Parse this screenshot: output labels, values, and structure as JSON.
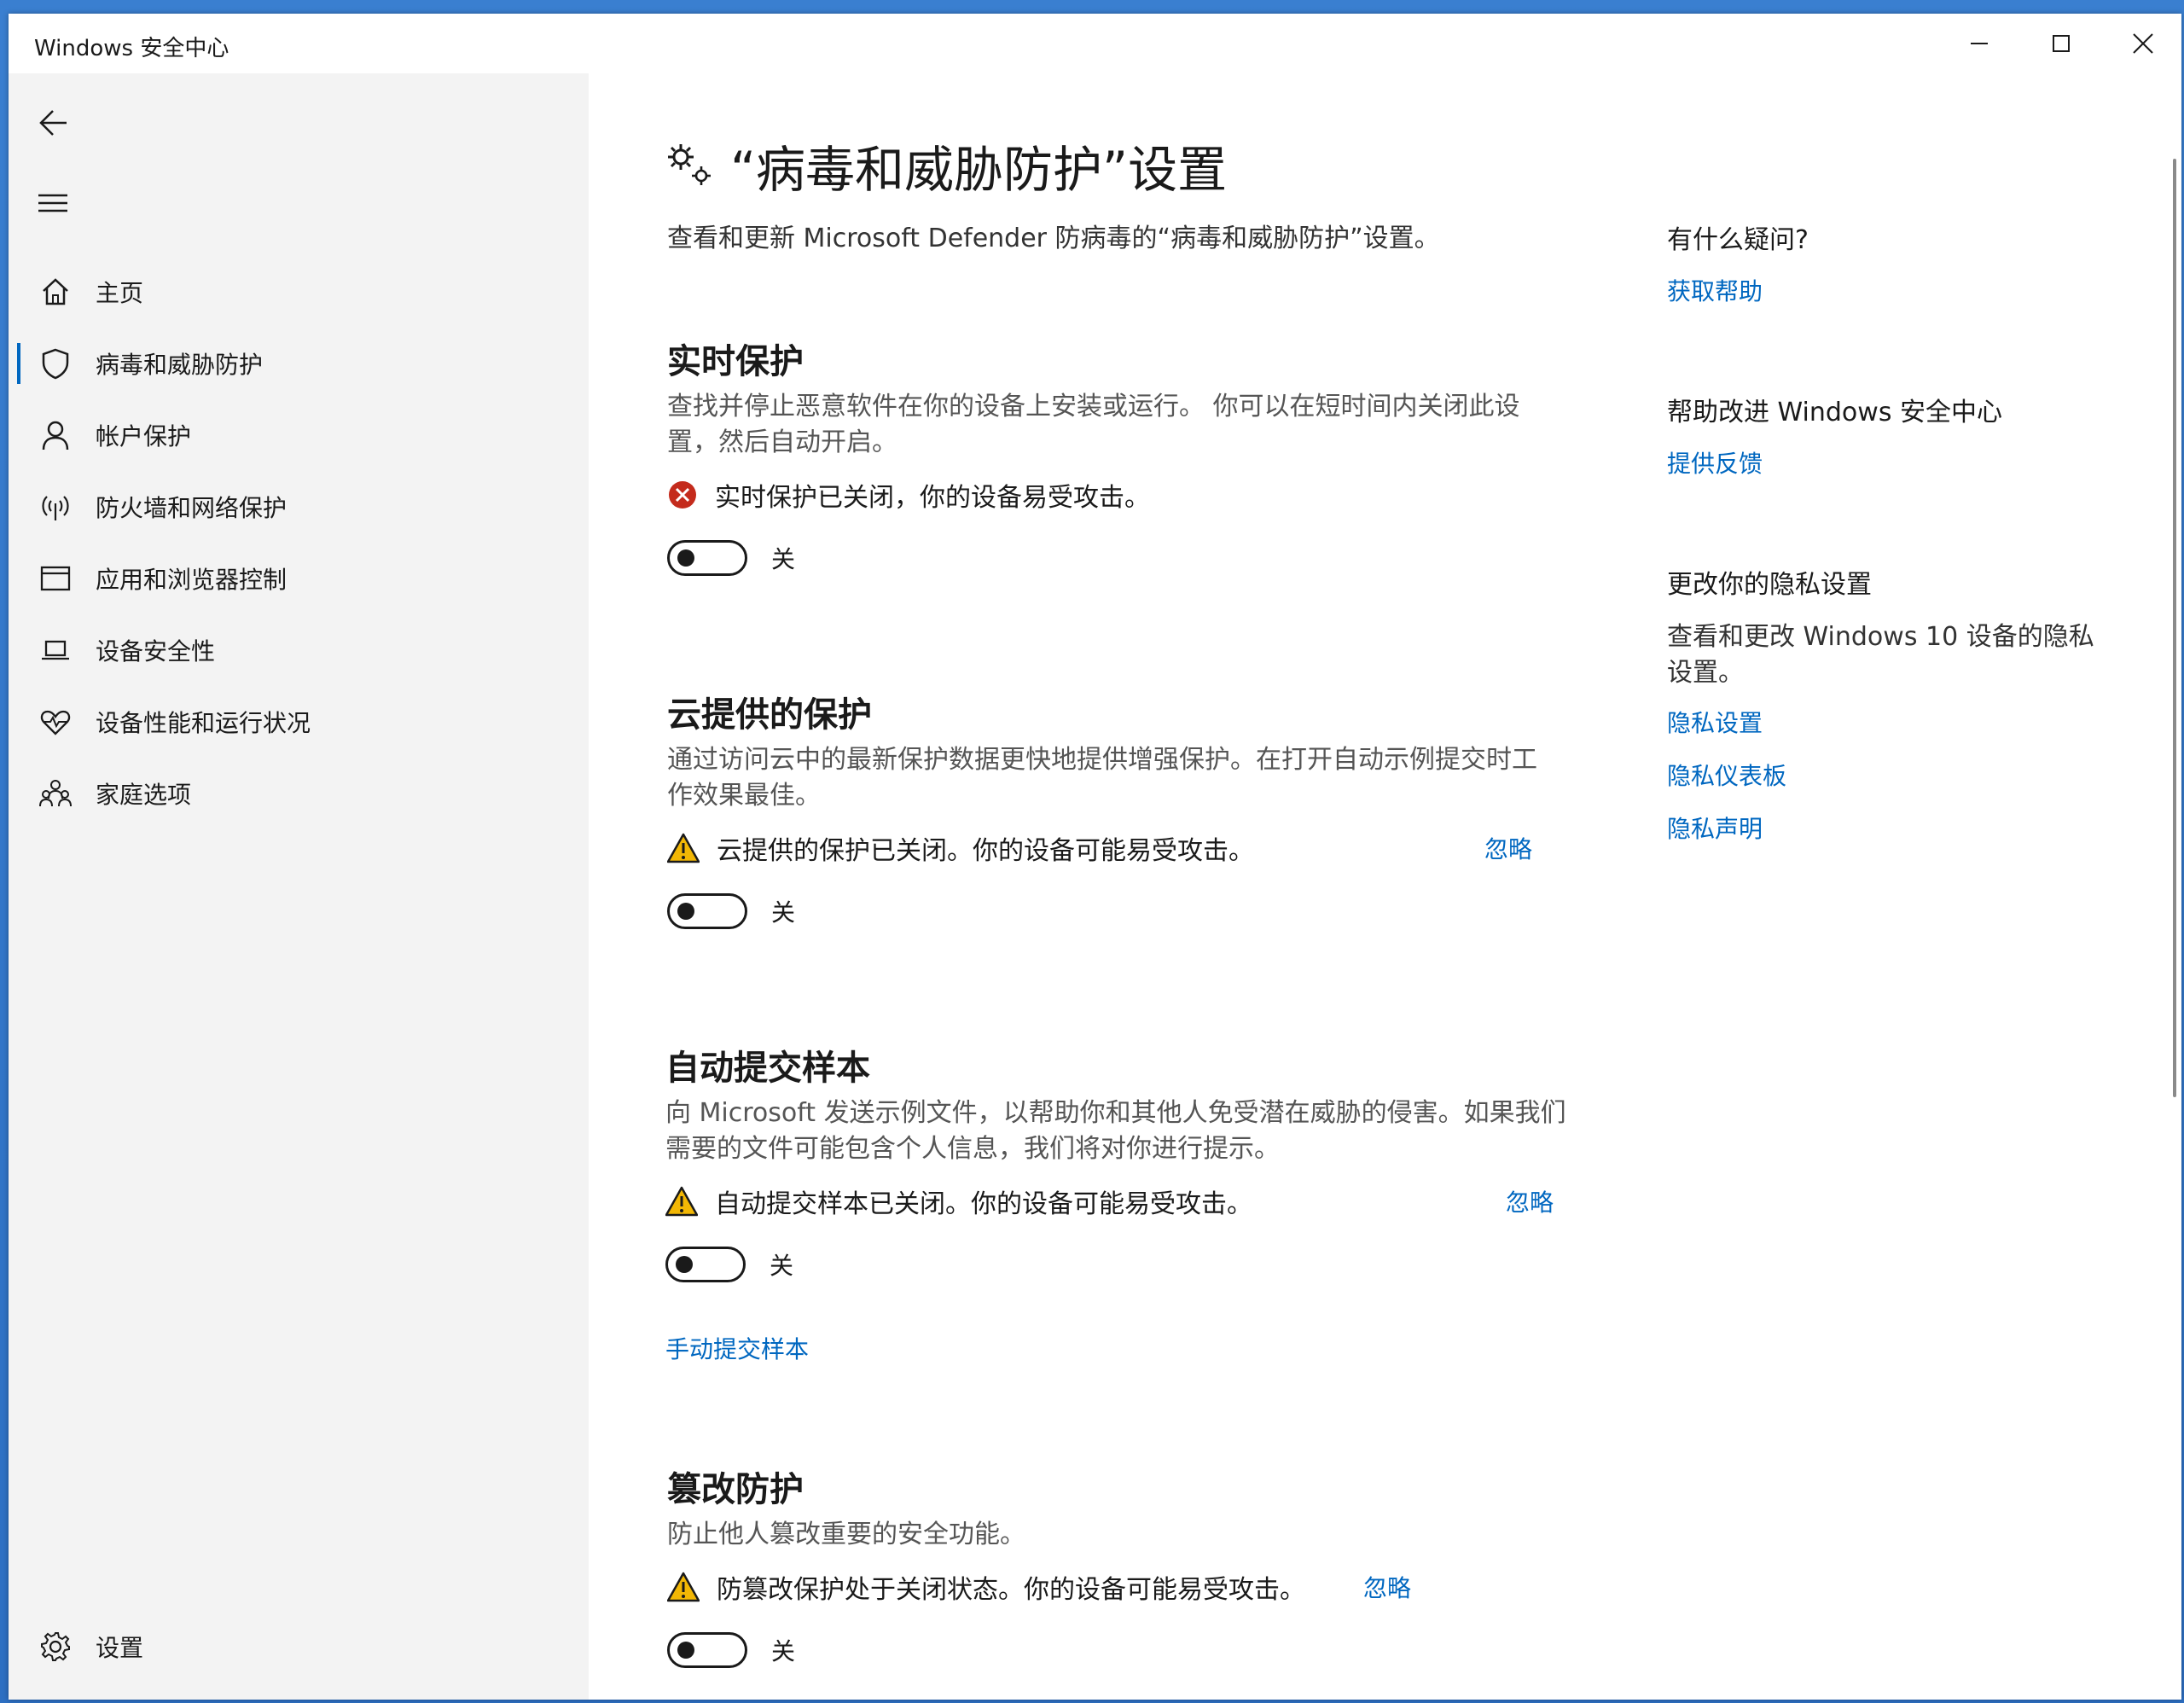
{
  "window": {
    "title": "Windows 安全中心"
  },
  "sidebar": {
    "items": [
      {
        "label": "主页",
        "icon": "home-icon"
      },
      {
        "label": "病毒和威胁防护",
        "icon": "shield-icon",
        "selected": true
      },
      {
        "label": "帐户保护",
        "icon": "person-icon"
      },
      {
        "label": "防火墙和网络保护",
        "icon": "wifi-antenna-icon"
      },
      {
        "label": "应用和浏览器控制",
        "icon": "browser-window-icon"
      },
      {
        "label": "设备安全性",
        "icon": "laptop-icon"
      },
      {
        "label": "设备性能和运行状况",
        "icon": "heart-icon"
      },
      {
        "label": "家庭选项",
        "icon": "family-icon"
      }
    ],
    "settings_label": "设置"
  },
  "main": {
    "title": "“病毒和威胁防护”设置",
    "description": "查看和更新 Microsoft Defender 防病毒的“病毒和威胁防护”设置。",
    "sections": [
      {
        "title": "实时保护",
        "description": "查找并停止恶意软件在你的设备上安装或运行。 你可以在短时间内关闭此设置，然后自动开启。",
        "status_text": "实时保护已关闭，你的设备易受攻击。",
        "status_type": "error",
        "toggle_label": "关"
      },
      {
        "title": "云提供的保护",
        "description": "通过访问云中的最新保护数据更快地提供增强保护。在打开自动示例提交时工作效果最佳。",
        "status_text": "云提供的保护已关闭。你的设备可能易受攻击。",
        "status_type": "warning",
        "ignore_label": "忽略",
        "toggle_label": "关"
      },
      {
        "title": "自动提交样本",
        "description": "向 Microsoft 发送示例文件，以帮助你和其他人免受潜在威胁的侵害。如果我们需要的文件可能包含个人信息，我们将对你进行提示。",
        "status_text": "自动提交样本已关闭。你的设备可能易受攻击。",
        "status_type": "warning",
        "ignore_label": "忽略",
        "toggle_label": "关",
        "link_label": "手动提交样本"
      },
      {
        "title": "篡改防护",
        "description": "防止他人篡改重要的安全功能。",
        "status_text": "防篡改保护处于关闭状态。你的设备可能易受攻击。",
        "status_type": "warning",
        "ignore_label": "忽略",
        "toggle_label": "关"
      }
    ]
  },
  "right": {
    "question_heading": "有什么疑问?",
    "help_link": "获取帮助",
    "improve_heading": "帮助改进 Windows 安全中心",
    "feedback_link": "提供反馈",
    "privacy_heading": "更改你的隐私设置",
    "privacy_desc": "查看和更改 Windows 10 设备的隐私设置。",
    "privacy_links": [
      "隐私设置",
      "隐私仪表板",
      "隐私声明"
    ]
  },
  "colors": {
    "accent": "#0067c0",
    "error": "#c42b1c",
    "warning": "#f2b705"
  }
}
